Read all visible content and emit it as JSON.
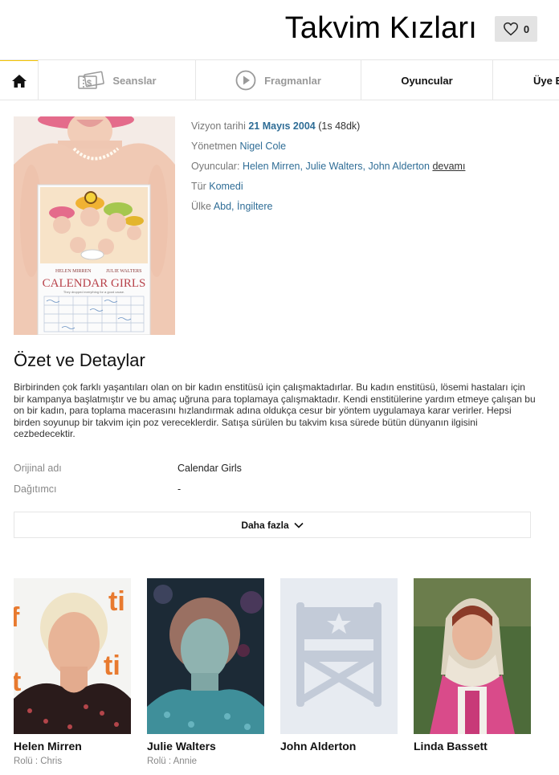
{
  "header": {
    "title": "Takvim Kızları",
    "favorite_count": "0"
  },
  "tabs": [
    {
      "label": "Seanslar"
    },
    {
      "label": "Fragmanlar"
    },
    {
      "label": "Oyuncular"
    },
    {
      "label": "Üye E"
    }
  ],
  "poster": {
    "top_names": [
      "HELEN MIRREN",
      "JULIE WALTERS"
    ],
    "logo": "CALENDAR GIRLS",
    "tagline": "They dropped everything for a good cause."
  },
  "info": {
    "release_label": "Vizyon tarihi",
    "release_date": "21 Mayıs 2004",
    "duration": "(1s 48dk)",
    "director_label": "Yönetmen",
    "director": "Nigel Cole",
    "cast_label": "Oyuncular:",
    "cast_1": "Helen Mirren,",
    "cast_2": "Julie Walters,",
    "cast_3": "John Alderton",
    "cast_more": "devamı",
    "genre_label": "Tür",
    "genre": "Komedi",
    "country_label": "Ülke",
    "country_1": "Abd,",
    "country_2": "İngiltere"
  },
  "summary": {
    "title": "Özet ve Detaylar",
    "text": "Birbirinden çok farklı yaşantıları olan on bir kadın enstitüsü için çalışmaktadırlar. Bu kadın enstitüsü, lösemi hastaları için bir kampanya başlatmıştır ve bu amaç uğruna para toplamaya çalışmaktadır. Kendi enstitülerine yardım etmeye çalışan bu on bir kadın, para toplama macerasını hızlandırmak adına oldukça cesur bir yöntem uygulamaya karar verirler. Hepsi birden soyunup bir takvim için poz vereceklerdir. Satışa sürülen bu takvim kısa sürede bütün dünyanın ilgisini cezbedecektir."
  },
  "details": [
    {
      "label": "Orijinal adı",
      "value": "Calendar Girls"
    },
    {
      "label": "Dağıtımcı",
      "value": "-"
    }
  ],
  "more_button": "Daha fazla",
  "cast": [
    {
      "name": "Helen Mirren",
      "role": "Rolü : Chris"
    },
    {
      "name": "Julie Walters",
      "role": "Rolü : Annie"
    },
    {
      "name": "John Alderton",
      "role": ""
    },
    {
      "name": "Linda Bassett",
      "role": ""
    }
  ],
  "colors": {
    "accent": "#f5c400",
    "link": "#2f6d96"
  }
}
